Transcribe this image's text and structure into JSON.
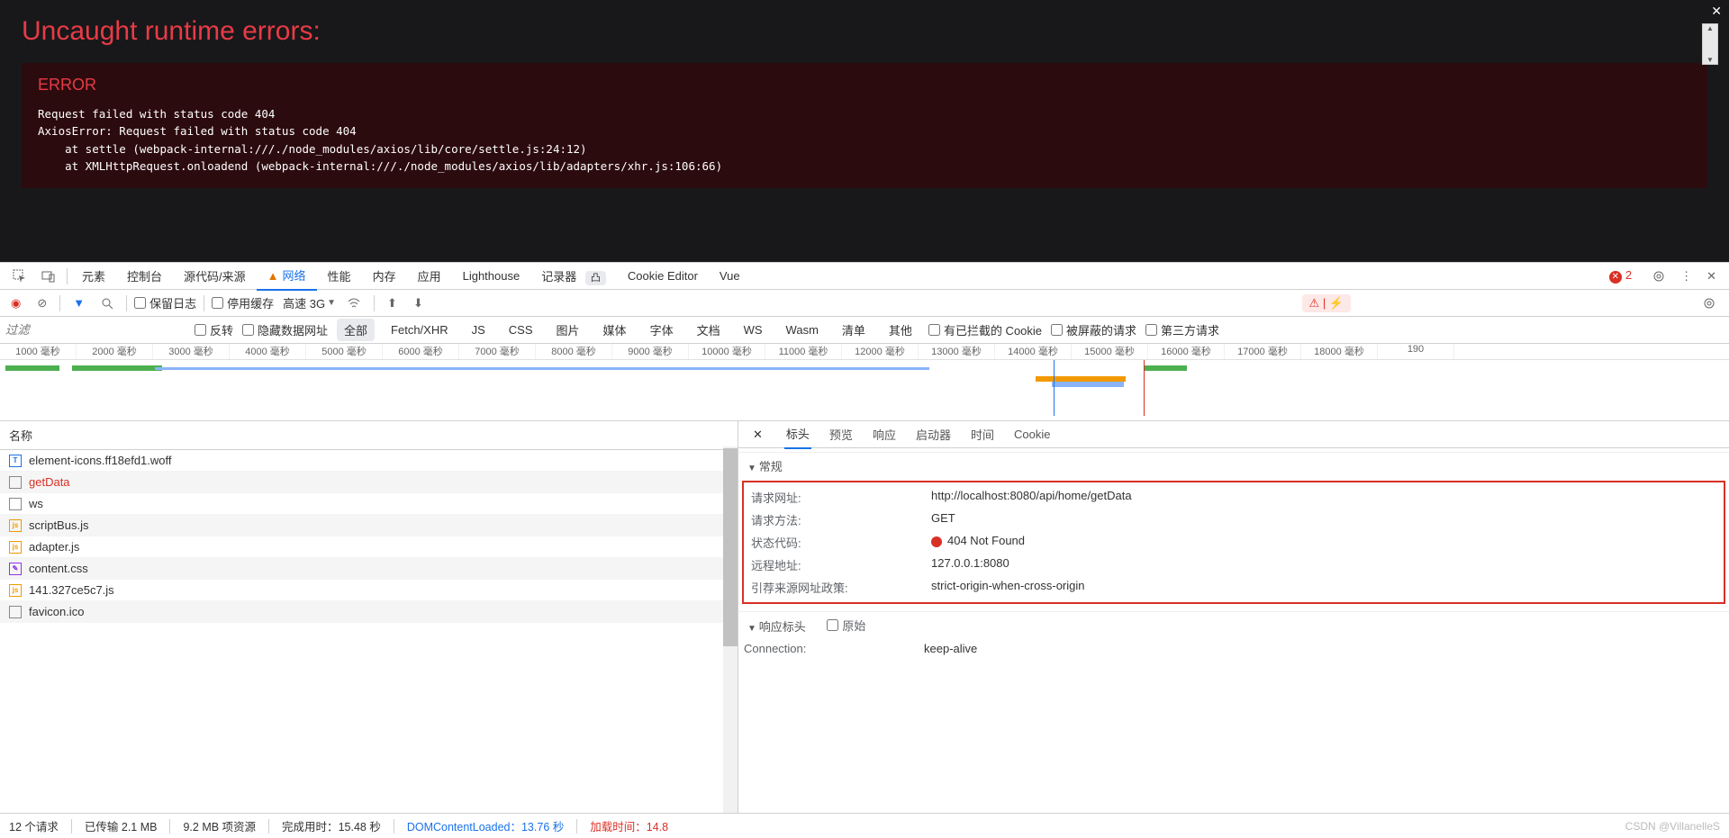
{
  "overlay": {
    "heading": "Uncaught runtime errors:",
    "title": "ERROR",
    "trace": "Request failed with status code 404\nAxiosError: Request failed with status code 404\n    at settle (webpack-internal:///./node_modules/axios/lib/core/settle.js:24:12)\n    at XMLHttpRequest.onloadend (webpack-internal:///./node_modules/axios/lib/adapters/xhr.js:106:66)"
  },
  "tabs": {
    "elements": "元素",
    "console": "控制台",
    "sources": "源代码/来源",
    "network": "网络",
    "performance": "性能",
    "memory": "内存",
    "application": "应用",
    "lighthouse": "Lighthouse",
    "recorder": "记录器",
    "cookie_editor": "Cookie Editor",
    "vue": "Vue",
    "recorder_pill": "凸",
    "error_count": "2"
  },
  "toolbar": {
    "preserve_log": "保留日志",
    "disable_cache": "停用缓存",
    "throttle": "高速 3G",
    "badge": "⚠ | ⚡"
  },
  "filter": {
    "placeholder": "过滤",
    "invert": "反转",
    "hide_data_urls": "隐藏数据网址",
    "chips": {
      "all": "全部",
      "fetch": "Fetch/XHR",
      "js": "JS",
      "css": "CSS",
      "img": "图片",
      "media": "媒体",
      "font": "字体",
      "doc": "文档",
      "ws": "WS",
      "wasm": "Wasm",
      "manifest": "清单",
      "other": "其他"
    },
    "blocked_cookies": "有已拦截的 Cookie",
    "blocked_requests": "被屏蔽的请求",
    "third_party": "第三方请求"
  },
  "timeline": {
    "ticks": [
      "1000 毫秒",
      "2000 毫秒",
      "3000 毫秒",
      "4000 毫秒",
      "5000 毫秒",
      "6000 毫秒",
      "7000 毫秒",
      "8000 毫秒",
      "9000 毫秒",
      "10000 毫秒",
      "11000 毫秒",
      "12000 毫秒",
      "13000 毫秒",
      "14000 毫秒",
      "15000 毫秒",
      "16000 毫秒",
      "17000 毫秒",
      "18000 毫秒",
      "190"
    ]
  },
  "requests": {
    "header": "名称",
    "items": [
      {
        "icon": "T",
        "cls": "fi-blue",
        "name": "element-icons.ff18efd1.woff"
      },
      {
        "icon": "",
        "cls": "fi-gray",
        "name": "getData",
        "selected": true
      },
      {
        "icon": "",
        "cls": "fi-gray",
        "name": "ws"
      },
      {
        "icon": "js",
        "cls": "fi-orange",
        "name": "scriptBus.js"
      },
      {
        "icon": "js",
        "cls": "fi-orange",
        "name": "adapter.js"
      },
      {
        "icon": "✎",
        "cls": "fi-purple",
        "name": "content.css"
      },
      {
        "icon": "js",
        "cls": "fi-orange",
        "name": "141.327ce5c7.js"
      },
      {
        "icon": "",
        "cls": "fi-gray",
        "name": "favicon.ico"
      }
    ]
  },
  "detail": {
    "tabs": {
      "headers": "标头",
      "preview": "预览",
      "response": "响应",
      "initiator": "启动器",
      "timing": "时间",
      "cookies": "Cookie"
    },
    "general_title": "常规",
    "general": [
      {
        "k": "请求网址:",
        "v": "http://localhost:8080/api/home/getData"
      },
      {
        "k": "请求方法:",
        "v": "GET"
      },
      {
        "k": "状态代码:",
        "v": "404 Not Found",
        "status": true
      },
      {
        "k": "远程地址:",
        "v": "127.0.0.1:8080"
      },
      {
        "k": "引荐来源网址政策:",
        "v": "strict-origin-when-cross-origin"
      }
    ],
    "resp_hdr_title": "响应标头",
    "raw_label": "原始",
    "resp_headers": [
      {
        "k": "Connection:",
        "v": "keep-alive"
      }
    ]
  },
  "status": {
    "requests": "12 个请求",
    "transferred": "已传输 2.1 MB",
    "resources": "9.2 MB 项资源",
    "finish_label": "完成用时：",
    "finish_val": "15.48 秒",
    "dom_label": "DOMContentLoaded：",
    "dom_val": "13.76 秒",
    "load_label": "加载时间：",
    "load_val": "14.8"
  },
  "watermark": "CSDN @VillanelleS"
}
